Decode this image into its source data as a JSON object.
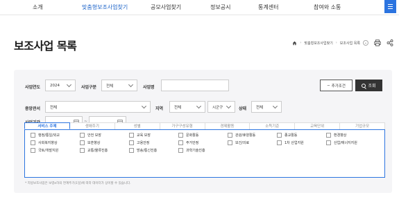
{
  "nav": {
    "items": [
      "소개",
      "맞춤형보조사업찾기",
      "공모사업찾기",
      "정보공시",
      "통계센터",
      "참여와 소통"
    ],
    "active_index": 1,
    "menu_icon": "hamburger-menu-icon"
  },
  "page": {
    "title": "보조사업 목록",
    "breadcrumb": [
      "맞춤형보조사업찾기",
      "보조사업 목록"
    ],
    "home_icon": "home-icon",
    "print_icon": "print-icon",
    "share_icon": "share-icon"
  },
  "search": {
    "year_label": "사업연도",
    "year_value": "2024",
    "type_label": "사업구분",
    "type_value": "전체",
    "name_label": "사업명",
    "name_value": "",
    "add_condition_label": "추가조건",
    "search_button_label": "조회",
    "ministry_label": "중앙관서",
    "ministry_value": "전체",
    "region_label": "지역",
    "region_value": "전체",
    "district_value": "시군구",
    "status_label": "상태",
    "status_value": "전체",
    "period_label": "사업기간",
    "period_from": "",
    "period_to": ""
  },
  "tabs": [
    "서비스 주제",
    "생애주기",
    "성별",
    "가구구성유형",
    "경제활동",
    "소득기준",
    "교육단위",
    "기업규모"
  ],
  "active_tab": 0,
  "checkboxes": [
    [
      "행정/통일/외교",
      "안전 보장",
      "교육 보장",
      "문화활동",
      "관광/휴양활동",
      "종교활동",
      "환경향상"
    ],
    [
      "사회복지향상",
      "보훈향상",
      "고용안정",
      "주거안정",
      "보건/의료",
      "1차 산업지원",
      "산업/에너지지원"
    ],
    [
      "국토/개발지원",
      "교통/물류진흥",
      "방송/통신진흥",
      "과학기술진흥"
    ]
  ],
  "notice": "* 지방보조사업은 보령e하의 연계주기(1일)에 따라 데이터가 상이할 수 있습니다.",
  "colors": {
    "accent": "#2b74e0",
    "active_nav": "#1d64c9",
    "dark_button": "#333333"
  }
}
